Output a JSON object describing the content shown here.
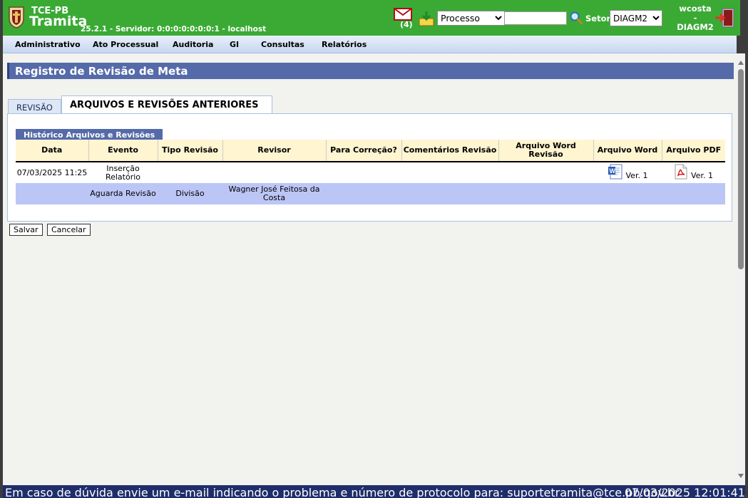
{
  "header": {
    "brand_small": "TCE-PB",
    "brand_big": "Tramita",
    "server_info": "25.2.1 - Servidor: 0:0:0:0:0:0:0:1 - localhost",
    "mail_count": "(4)",
    "search_type_value": "Processo",
    "search_value": "",
    "setor_label": "Setor",
    "setor_value": "DIAGM2",
    "user_name": "wcosta",
    "user_sep": "-",
    "user_setor": "DIAGM2",
    "colors": {
      "bar": "#3aaa35",
      "accent": "#556aa9"
    }
  },
  "menu": {
    "items": [
      "Administrativo",
      "Ato Processual",
      "Auditoria",
      "GI",
      "Consultas",
      "Relatórios"
    ]
  },
  "page": {
    "title": "Registro de Revisão de Meta",
    "tabs": [
      "REVISÃO",
      "ARQUIVOS E REVISÕES ANTERIORES"
    ],
    "section_title": "Histórico Arquivos e Revisões",
    "columns": [
      "Data",
      "Evento",
      "Tipo Revisão",
      "Revisor",
      "Para Correção?",
      "Comentários Revisão",
      "Arquivo Word Revisão",
      "Arquivo Word",
      "Arquivo PDF"
    ],
    "rows": [
      {
        "data": "07/03/2025 11:25",
        "evento": "Inserção Relatório",
        "tipo": "",
        "revisor": "",
        "correcao": "",
        "comentarios": "",
        "word_revisao": "",
        "word": "Ver. 1",
        "pdf": "Ver. 1"
      },
      {
        "data": "",
        "evento": "Aguarda Revisão",
        "tipo": "Divisão",
        "revisor": "Wagner José Feitosa da Costa",
        "correcao": "",
        "comentarios": "",
        "word_revisao": "",
        "word": "",
        "pdf": ""
      }
    ],
    "buttons": {
      "save": "Salvar",
      "cancel": "Cancelar"
    }
  },
  "footer": {
    "message": "Em caso de dúvida envie um e-mail indicando o problema e número de protocolo para: suportetramita@tce.pb.gov.br",
    "timestamp": "07/03/2025 12:01:41"
  }
}
